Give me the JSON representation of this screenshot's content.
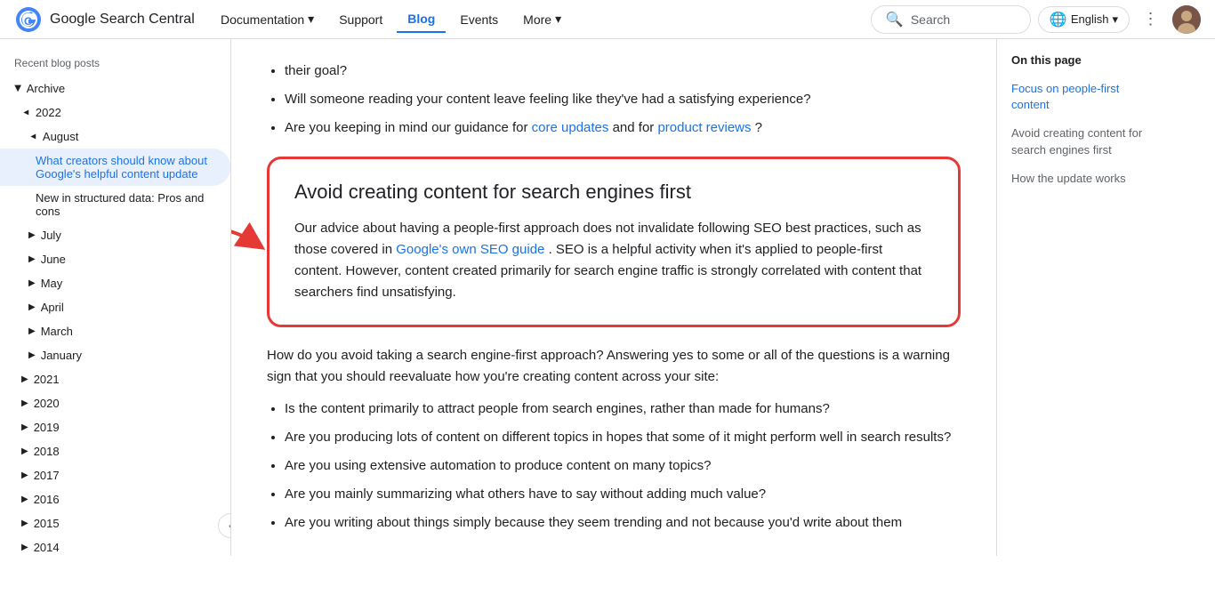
{
  "nav": {
    "logo_text": "Google Search Central",
    "links": [
      {
        "label": "Documentation",
        "has_dropdown": true,
        "active": false
      },
      {
        "label": "Support",
        "has_dropdown": false,
        "active": false
      },
      {
        "label": "Blog",
        "has_dropdown": false,
        "active": true
      },
      {
        "label": "Events",
        "has_dropdown": false,
        "active": false
      },
      {
        "label": "More",
        "has_dropdown": true,
        "active": false
      }
    ],
    "search_placeholder": "Search",
    "language": "English"
  },
  "sidebar": {
    "section_title": "Recent blog posts",
    "archive_label": "Archive",
    "items": [
      {
        "label": "2022",
        "level": 1,
        "open": true
      },
      {
        "label": "August",
        "level": 2,
        "open": true
      },
      {
        "label": "What creators should know about Google's helpful content update",
        "level": 3,
        "active": true
      },
      {
        "label": "New in structured data: Pros and cons",
        "level": 3,
        "active": false
      },
      {
        "label": "July",
        "level": 2,
        "open": false
      },
      {
        "label": "June",
        "level": 2,
        "open": false
      },
      {
        "label": "May",
        "level": 2,
        "open": false
      },
      {
        "label": "April",
        "level": 2,
        "open": false
      },
      {
        "label": "March",
        "level": 2,
        "open": false
      },
      {
        "label": "January",
        "level": 2,
        "open": false
      },
      {
        "label": "2021",
        "level": 1,
        "open": false
      },
      {
        "label": "2020",
        "level": 1,
        "open": false
      },
      {
        "label": "2019",
        "level": 1,
        "open": false
      },
      {
        "label": "2018",
        "level": 1,
        "open": false
      },
      {
        "label": "2017",
        "level": 1,
        "open": false
      },
      {
        "label": "2016",
        "level": 1,
        "open": false
      },
      {
        "label": "2015",
        "level": 1,
        "open": false
      },
      {
        "label": "2014",
        "level": 1,
        "open": false
      }
    ]
  },
  "content": {
    "pre_items": [
      "their goal?",
      "Will someone reading your content leave feeling like they've had a satisfying experience?",
      "Are you keeping in mind our guidance for core updates and for product reviews?"
    ],
    "section_title": "Avoid creating content for search engines first",
    "section_body": "Our advice about having a people-first approach does not invalidate following SEO best practices, such as those covered in Google's own SEO guide. SEO is a helpful activity when it's applied to people-first content. However, content created primarily for search engine traffic is strongly correlated with content that searchers find unsatisfying.",
    "warning_intro": "How do you avoid taking a search engine-first approach? Answering yes to some or all of the questions is a warning sign that you should reevaluate how you're creating content across your site:",
    "warning_items": [
      "Is the content primarily to attract people from search engines, rather than made for humans?",
      "Are you producing lots of content on different topics in hopes that some of it might perform well in search results?",
      "Are you using extensive automation to produce content on many topics?",
      "Are you mainly summarizing what others have to say without adding much value?",
      "Are you writing about things simply because they seem trending and not because you'd write about them"
    ],
    "link_core_updates": "core updates",
    "link_product_reviews": "product reviews",
    "link_seo_guide": "Google's own SEO guide"
  },
  "toc": {
    "title": "On this page",
    "items": [
      {
        "label": "Focus on people-first content",
        "active": true
      },
      {
        "label": "Avoid creating content for search engines first",
        "active": false
      },
      {
        "label": "How the update works",
        "active": false
      }
    ]
  }
}
